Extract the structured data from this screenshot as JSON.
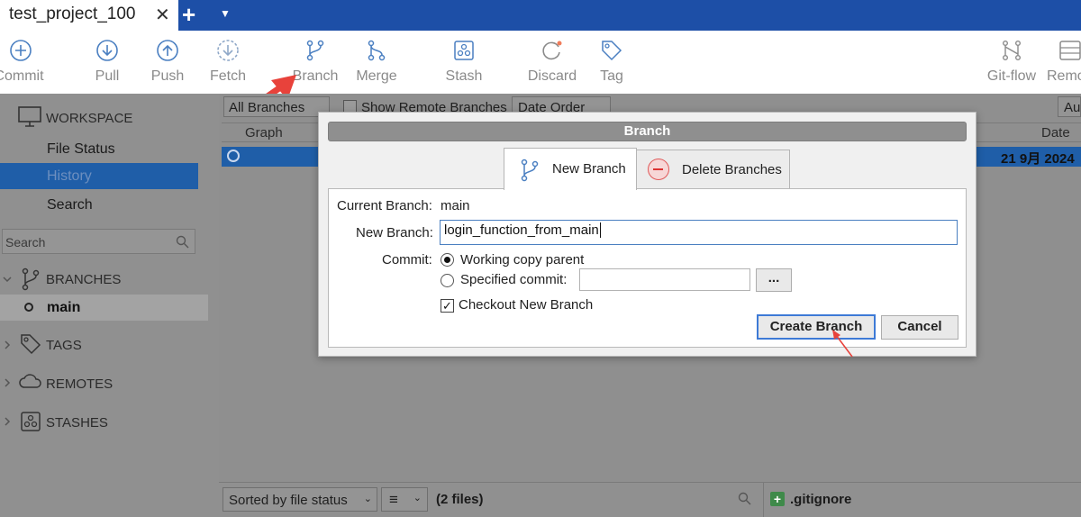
{
  "tab": {
    "title": "test_project_100"
  },
  "toolbar": {
    "commit": "Commit",
    "pull": "Pull",
    "push": "Push",
    "fetch": "Fetch",
    "branch": "Branch",
    "merge": "Merge",
    "stash": "Stash",
    "discard": "Discard",
    "tag": "Tag",
    "gitflow": "Git-flow",
    "remote": "Remote"
  },
  "sidebar": {
    "workspace": "WORKSPACE",
    "file_status": "File Status",
    "history": "History",
    "search": "Search",
    "search_placeholder": "Search",
    "branches": "BRANCHES",
    "main_branch": "main",
    "tags": "TAGS",
    "remotes": "REMOTES",
    "stashes": "STASHES"
  },
  "filters": {
    "branches": "All Branches",
    "show_remote": "Show Remote Branches",
    "order": "Date Order",
    "auto": "Auto"
  },
  "columns": {
    "graph": "Graph",
    "date": "Date"
  },
  "commit_row": {
    "date": "21 9月 2024"
  },
  "bottom": {
    "sort": "Sorted by file status",
    "files": "(2 files)",
    "file": ".gitignore"
  },
  "dialog": {
    "title": "Branch",
    "tab_new": "New Branch",
    "tab_delete": "Delete Branches",
    "current_label": "Current Branch:",
    "current_value": "main",
    "new_label": "New Branch:",
    "new_value": "login_function_from_main",
    "commit_label": "Commit:",
    "opt_working": "Working copy parent",
    "opt_specified": "Specified commit:",
    "browse": "...",
    "checkout": "Checkout New Branch",
    "create": "Create Branch",
    "cancel": "Cancel"
  },
  "colors": {
    "accent": "#1d4fa7",
    "selection": "#1f5ea8",
    "annotation_arrow": "#e8423b"
  }
}
